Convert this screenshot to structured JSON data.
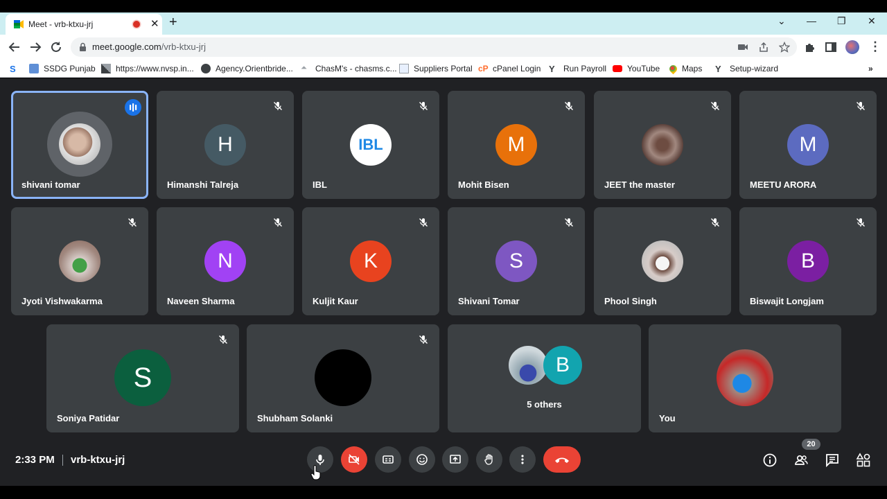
{
  "browser": {
    "tab_title": "Meet - vrb-ktxu-jrj",
    "url_host": "meet.google.com",
    "url_path": "/vrb-ktxu-jrj",
    "bookmarks": [
      {
        "label": "SSDG Punjab"
      },
      {
        "label": "https://www.nvsp.in..."
      },
      {
        "label": "Agency.Orientbride..."
      },
      {
        "label": "ChasM's - chasms.c..."
      },
      {
        "label": "Suppliers Portal"
      },
      {
        "label": "cPanel Login"
      },
      {
        "label": "Run Payroll"
      },
      {
        "label": "YouTube"
      },
      {
        "label": "Maps"
      },
      {
        "label": "Setup-wizard"
      }
    ]
  },
  "meet": {
    "participants": [
      {
        "name": "shivani tomar",
        "initial": "",
        "color": "#5f6368",
        "photo": true,
        "speaking": true
      },
      {
        "name": "Himanshi Talreja",
        "initial": "H",
        "color": "#455a64"
      },
      {
        "name": "IBL",
        "initial": "IBL",
        "color": "#ffffff",
        "logo": true
      },
      {
        "name": "Mohit Bisen",
        "initial": "M",
        "color": "#e8710a"
      },
      {
        "name": "JEET the master",
        "initial": "",
        "color": "#6d4c41",
        "photo": true
      },
      {
        "name": "MEETU ARORA",
        "initial": "M",
        "color": "#5c6bc0"
      },
      {
        "name": "Jyoti Vishwakarma",
        "initial": "",
        "color": "#8d6e63",
        "photo": true
      },
      {
        "name": "Naveen Sharma",
        "initial": "N",
        "color": "#a142f4"
      },
      {
        "name": "Kuljit Kaur",
        "initial": "K",
        "color": "#e8431f"
      },
      {
        "name": "Shivani Tomar",
        "initial": "S",
        "color": "#7e57c2"
      },
      {
        "name": "Phool Singh",
        "initial": "",
        "color": "#bdbdbd",
        "photo": true
      },
      {
        "name": "Biswajit Longjam",
        "initial": "B",
        "color": "#7b1fa2"
      },
      {
        "name": "Soniya Patidar",
        "initial": "S",
        "color": "#0b5f3e"
      },
      {
        "name": "Shubham Solanki",
        "initial": "",
        "color": "#000000"
      }
    ],
    "others": {
      "label": "5 others",
      "initial": "B",
      "color": "#12a4af"
    },
    "you": {
      "name": "You"
    },
    "time": "2:33 PM",
    "meeting_code": "vrb-ktxu-jrj",
    "people_count": "20",
    "accent_color": "#8ab4f8",
    "leave_color": "#ea4335"
  }
}
